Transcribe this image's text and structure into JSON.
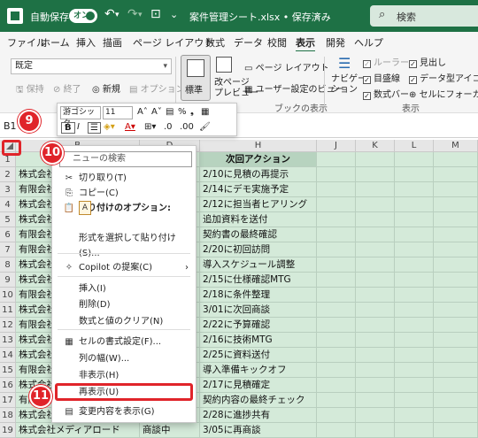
{
  "titlebar": {
    "autosave_label": "自動保存",
    "toggle_label": "オン",
    "filename": "案件管理シート.xlsx • 保存済み",
    "search_placeholder": "検索"
  },
  "menu": {
    "tabs": [
      "ファイル",
      "ホーム",
      "挿入",
      "描画",
      "ページ レイアウト",
      "数式",
      "データ",
      "校閲",
      "表示",
      "開発",
      "ヘルプ"
    ],
    "active": "表示"
  },
  "ribbon": {
    "style_value": "既定",
    "save_label": "保持",
    "exit_label": "終了",
    "new_label": "新規",
    "options_label": "オプション",
    "standard_label": "標準",
    "pagebreak_label": "改ページ\nプレビュー",
    "page_layout_label": "ページ レイアウト",
    "custom_view_label": "ユーザー設定のビュー",
    "book_view_caption": "ブックの表示",
    "navigation_label": "ナビゲー\nション",
    "ruler_label": "ルーラー",
    "gridlines_label": "目盛線",
    "formula_bar_label": "数式バー",
    "headings_label": "見出し",
    "data_icon_label": "データ型アイコン",
    "cell_focus_label": "セルにフォーカス",
    "show_caption": "表示"
  },
  "minitoolbar": {
    "font": "游ゴシック",
    "size": "11"
  },
  "formulabar": {
    "namebox": "B1"
  },
  "grid": {
    "columns": [
      "B",
      "D",
      "H",
      "J",
      "K",
      "L",
      "M"
    ],
    "header_cell": "次回アクション",
    "rows": [
      {
        "num": "1",
        "b": "",
        "d": "",
        "h": "次回アクション"
      },
      {
        "num": "2",
        "b": "株式会社",
        "d": "",
        "h": "2/10に見積の再提示"
      },
      {
        "num": "3",
        "b": "有限会社",
        "d": "",
        "h": "2/14にデモ実施予定"
      },
      {
        "num": "4",
        "b": "株式会社",
        "d": "",
        "h": "2/12に担当者ヒアリング"
      },
      {
        "num": "5",
        "b": "株式会社",
        "d": "",
        "h": "追加資料を送付"
      },
      {
        "num": "6",
        "b": "有限会社",
        "d": "",
        "h": "契約書の最終確認"
      },
      {
        "num": "7",
        "b": "有限会社",
        "d": "",
        "h": "2/20に初回訪問"
      },
      {
        "num": "8",
        "b": "株式会社",
        "d": "",
        "h": "導入スケジュール調整"
      },
      {
        "num": "9",
        "b": "株式会社",
        "d": "",
        "h": "2/15に仕様確認MTG"
      },
      {
        "num": "10",
        "b": "有限会社",
        "d": "",
        "h": "2/18に条件整理"
      },
      {
        "num": "11",
        "b": "株式会社",
        "d": "",
        "h": "3/01に次回商談"
      },
      {
        "num": "12",
        "b": "有限会社",
        "d": "",
        "h": "2/22に予算確認"
      },
      {
        "num": "13",
        "b": "株式会社",
        "d": "",
        "h": "2/16に技術MTG"
      },
      {
        "num": "14",
        "b": "株式会社",
        "d": "",
        "h": "2/25に資料送付"
      },
      {
        "num": "15",
        "b": "有限会社",
        "d": "",
        "h": "導入準備キックオフ"
      },
      {
        "num": "16",
        "b": "株式会社",
        "d": "",
        "h": "2/17に見積確定"
      },
      {
        "num": "17",
        "b": "有限会社",
        "d": "",
        "h": "契約内容の最終チェック"
      },
      {
        "num": "18",
        "b": "株式会社",
        "d": "",
        "h": "2/28に進捗共有"
      },
      {
        "num": "19",
        "b": "株式会社メディアロード",
        "d": "商談中",
        "h": "3/05に再商談"
      }
    ]
  },
  "context_menu": {
    "search_placeholder": "ニューの検索",
    "items": [
      {
        "icon": "✂",
        "label": "切り取り(T)"
      },
      {
        "icon": "⎘",
        "label": "コピー(C)"
      },
      {
        "icon": "📋",
        "label": "貼り付けのオプション:"
      },
      {
        "icon": "",
        "label": "形式を選択して貼り付け(S)..."
      },
      {
        "icon": "✧",
        "label": "Copilot の提案(C)"
      },
      {
        "icon": "",
        "label": "挿入(I)"
      },
      {
        "icon": "",
        "label": "削除(D)"
      },
      {
        "icon": "",
        "label": "数式と値のクリア(N)"
      },
      {
        "icon": "▦",
        "label": "セルの書式設定(F)..."
      },
      {
        "icon": "",
        "label": "列の幅(W)..."
      },
      {
        "icon": "",
        "label": "非表示(H)"
      },
      {
        "icon": "",
        "label": "再表示(U)"
      },
      {
        "icon": "▤",
        "label": "変更内容を表示(G)"
      }
    ]
  },
  "steps": [
    "9",
    "10",
    "11"
  ],
  "colors": {
    "excel_green": "#1e7145",
    "highlight_red": "#e0242a"
  }
}
